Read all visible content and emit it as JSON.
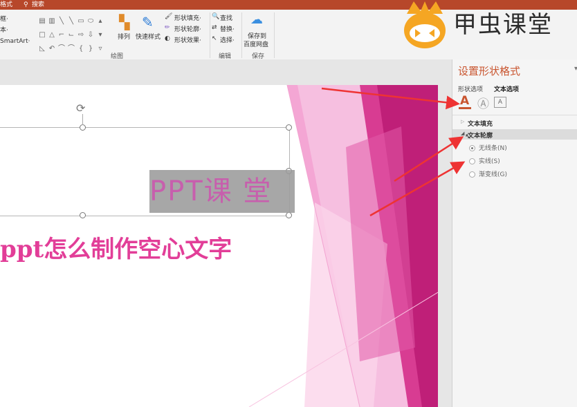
{
  "titlebar": {
    "tab_left": "格式",
    "search_label": "搜索"
  },
  "ribbon": {
    "left_items": [
      "框·",
      "本·",
      "SmartArt·"
    ],
    "arrange_label": "排列",
    "quick_styles_label": "快速样式",
    "shape_fill": "形状填充·",
    "shape_outline": "形状轮廓·",
    "shape_effects": "形状效果·",
    "find": "查找",
    "replace": "替换·",
    "select": "选择·",
    "save_to_line1": "保存到",
    "save_to_line2": "百度网盘",
    "group_drawing": "绘图",
    "group_edit": "编辑",
    "group_save": "保存"
  },
  "logo": {
    "text": "甲虫课堂",
    "color": "#f5a623"
  },
  "slide": {
    "title_text": "PPT课 堂",
    "subtitle_text": "ppt怎么制作空心文字"
  },
  "pane": {
    "title": "设置形状格式",
    "tab_shape": "形状选项",
    "tab_text": "文本选项",
    "icon_letter": "A",
    "section_fill": "文本填充",
    "section_outline": "文本轮廓",
    "option_none": "无线条(N)",
    "option_solid": "实线(S)",
    "option_gradient": "渐变线(G)"
  },
  "colors": {
    "accent": "#b7472a",
    "pane_title": "#c9552f",
    "slide_pink": "#e23e98",
    "arrow": "#ee3333"
  }
}
